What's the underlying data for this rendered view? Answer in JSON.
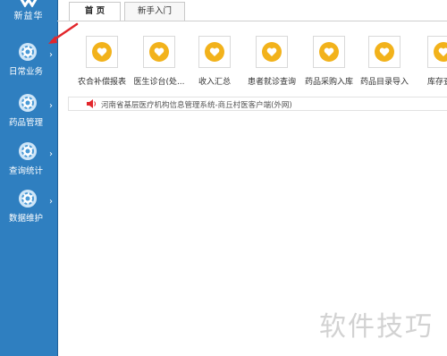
{
  "brand": {
    "name": "新益华"
  },
  "sidebar": {
    "items": [
      {
        "label": "日常业务",
        "icon": "gear-icon"
      },
      {
        "label": "药品管理",
        "icon": "gear-icon"
      },
      {
        "label": "查询统计",
        "icon": "gear-icon"
      },
      {
        "label": "数据维护",
        "icon": "gear-icon"
      }
    ]
  },
  "tabs": [
    {
      "label": "首 页",
      "active": true
    },
    {
      "label": "新手入门",
      "active": false
    }
  ],
  "apps": [
    {
      "label": "农合补偿报表",
      "icon": "heart-icon"
    },
    {
      "label": "医生诊台(处...",
      "icon": "heart-icon"
    },
    {
      "label": "收入汇总",
      "icon": "heart-icon"
    },
    {
      "label": "患者就诊查询",
      "icon": "heart-icon"
    },
    {
      "label": "药品采购入库",
      "icon": "heart-icon"
    },
    {
      "label": "药品目录导入",
      "icon": "heart-icon"
    },
    {
      "label": "库存查",
      "icon": "heart-icon"
    }
  ],
  "notice": {
    "text": "河南省基层医疗机构信息管理系统-商丘村医客户端(外网)",
    "icon": "speaker-icon"
  },
  "watermark": "软件技巧",
  "colors": {
    "sidebar": "#2f7fc0",
    "icon_yellow": "#f2b21b",
    "arrow": "#e2262b"
  }
}
